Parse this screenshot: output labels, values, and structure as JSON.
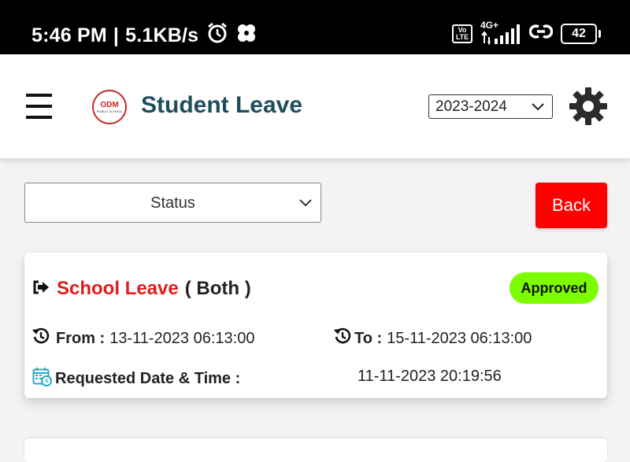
{
  "status_bar": {
    "time": "5:46 PM",
    "separator": "|",
    "net_speed": "5.1KB/s",
    "volte_top": "Vo",
    "volte_bottom": "LTE",
    "network": "4G+",
    "battery": "42"
  },
  "header": {
    "title": "Student Leave",
    "logo_text": "ODM",
    "logo_sub": "PUBLIC SCHOOL",
    "year_selected": "2023-2024"
  },
  "filters": {
    "status_selected": "Status",
    "back_label": "Back"
  },
  "leave_card": {
    "leave_type": "School Leave",
    "leave_mode": "( Both )",
    "status": "Approved",
    "from_label": "From :",
    "from_value": "13-11-2023 06:13:00",
    "to_label": "To :",
    "to_value": "15-11-2023 06:13:00",
    "requested_label": "Requested Date & Time :",
    "requested_value": "11-11-2023 20:19:56"
  },
  "colors": {
    "title": "#1e4e5e",
    "back_button": "#ff0000",
    "leave_type": "#e11b1b",
    "approved_badge": "#7cfc00"
  }
}
